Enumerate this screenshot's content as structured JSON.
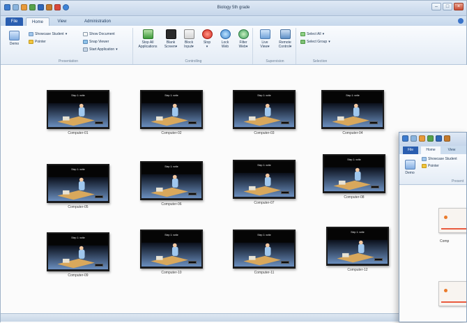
{
  "window": {
    "title": "Biology 5th grade",
    "quick_access_icons": [
      "grid-icon",
      "monitor-icon",
      "screens-icon",
      "filter-icon",
      "shield-icon",
      "wrench-icon",
      "colors-icon",
      "globe-icon"
    ]
  },
  "tabs": [
    {
      "label": "File"
    },
    {
      "label": "Home"
    },
    {
      "label": "View"
    },
    {
      "label": "Administration"
    }
  ],
  "ribbon": {
    "presentation": {
      "label": "Presentation",
      "demo": "Demo",
      "showcase_student": "Showcase Student",
      "pointer": "Pointer",
      "show_document": "Show Document",
      "snap_viewer": "Snap Viewer",
      "start_application": "Start Application"
    },
    "controlling": {
      "label": "Controlling",
      "stop_all_line1": "Stop All",
      "stop_all_line2": "Applications",
      "blank_line1": "Blank",
      "blank_line2": "Screen",
      "block_line1": "Block",
      "block_line2": "Input",
      "stop": "Stop",
      "lock_line1": "Lock",
      "lock_line2": "Web",
      "filter_line1": "Filter",
      "filter_line2": "Web"
    },
    "supervision": {
      "label": "Supervision",
      "live_line1": "Live",
      "live_line2": "View",
      "remote_line1": "Remote",
      "remote_line2": "Control"
    },
    "selection": {
      "label": "Selection",
      "select_all": "Select All",
      "select_group": "Select Group"
    }
  },
  "computers": [
    {
      "name": "Computer-01",
      "screen_text": "Step 1: write"
    },
    {
      "name": "Computer-02",
      "screen_text": "Step 1: write"
    },
    {
      "name": "Computer-03",
      "screen_text": "Step 1: write"
    },
    {
      "name": "Computer-04",
      "screen_text": "Step 1: write"
    },
    {
      "name": "Computer-05",
      "screen_text": "Step 1: write"
    },
    {
      "name": "Computer-06",
      "screen_text": "Step 1: write"
    },
    {
      "name": "Computer-07",
      "screen_text": "Step 1: write"
    },
    {
      "name": "Computer-08",
      "screen_text": "Step 1: write"
    },
    {
      "name": "Computer-09",
      "screen_text": "Step 1: write"
    },
    {
      "name": "Computer-10",
      "screen_text": "Step 1: write"
    },
    {
      "name": "Computer-11",
      "screen_text": "Step 1: write"
    },
    {
      "name": "Computer-12",
      "screen_text": "Step 1: write"
    }
  ],
  "second_window": {
    "tabs": [
      "File",
      "Home",
      "View"
    ],
    "showcase_student": "Showcase Student",
    "pointer": "Pointer",
    "demo": "Demo",
    "group_label": "Present",
    "thumb_label": "Comp"
  }
}
